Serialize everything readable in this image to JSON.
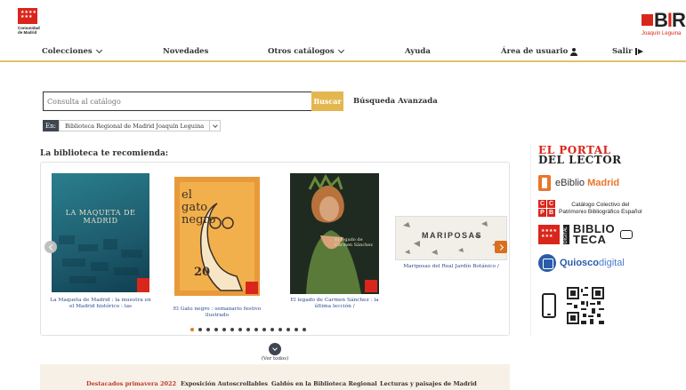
{
  "header": {
    "madrid_logo_text": "Comunidad de Madrid",
    "library_logo_caption": "Joaquín Leguina"
  },
  "nav": {
    "items": [
      {
        "label": "Colecciones",
        "has_dropdown": true
      },
      {
        "label": "Novedades",
        "has_dropdown": false
      },
      {
        "label": "Otros catálogos",
        "has_dropdown": true
      },
      {
        "label": "Ayuda",
        "has_dropdown": false
      },
      {
        "label": "Área de usuario",
        "icon": "user-icon"
      },
      {
        "label": "Salir",
        "icon": "exit-icon"
      }
    ]
  },
  "search": {
    "placeholder": "Consulta al catálogo",
    "button_label": "Buscar",
    "advanced_label": "Búsqueda Avanzada",
    "scope_prefix": "En:",
    "scope_value": "Biblioteca Regional de Madrid Joaquín Leguina"
  },
  "recommendations": {
    "title": "La biblioteca te recomienda:",
    "books": [
      {
        "cover_title": "LA MAQUETA DE MADRID",
        "caption": "La Maqueta de Madrid : la muestra en el Madrid histórico : las"
      },
      {
        "cover_title": "el gato negro",
        "cover_year": "20",
        "caption": "El Gato negro : semanario festivo ilustrado"
      },
      {
        "cover_title": "El legado de Carmen Sánchez",
        "caption": "El legado de Carmen Sánchez : la última lección /"
      },
      {
        "cover_title": "MARIPOSAS",
        "caption": "Mariposas del Real Jardín Botánico /"
      }
    ],
    "total_slides": 15,
    "active_slide": 0,
    "see_all_label": "(Ver todos)"
  },
  "bottom_tabs": [
    {
      "label": "Destacados primavera 2022",
      "active": true
    },
    {
      "label": "Exposición Autoscrollables",
      "active": false
    },
    {
      "label": "Galdós en la Biblioteca Regional",
      "active": false
    },
    {
      "label": "Lecturas y paisajes de Madrid",
      "active": false
    }
  ],
  "sidebar": {
    "portal_line1": "EL PORTAL",
    "portal_line2": "DEL LECTOR",
    "ebiblio_prefix": "eBiblio",
    "ebiblio_suffix": "Madrid",
    "ccpb_letters": [
      "C",
      "C",
      "P",
      "B"
    ],
    "ccpb_line1": "Catálogo Colectivo del",
    "ccpb_line2": "Patrimonio Bibliográfico Español",
    "bibteca_vertical": "DIGITAL",
    "bibteca_line1": "BIBLIO",
    "bibteca_line2": "TECA",
    "quiosco_prefix": "Quiosco",
    "quiosco_suffix": "digital"
  },
  "colors": {
    "accent_gold": "#e3b64f",
    "brand_red": "#d9261c",
    "active_orange": "#e07a1f",
    "link_blue": "#2a4a8a"
  }
}
